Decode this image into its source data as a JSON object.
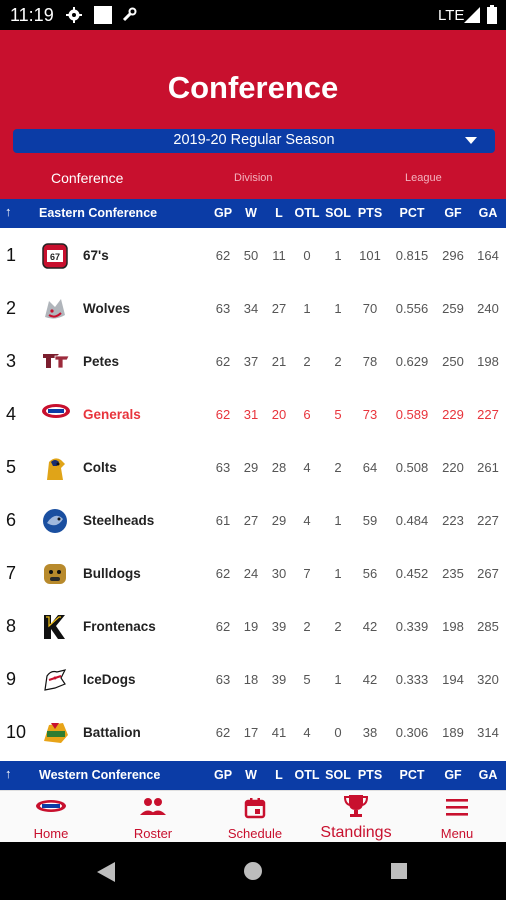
{
  "status_bar": {
    "time": "11:19",
    "network": "LTE"
  },
  "header": {
    "title": "Conference",
    "season": "2019-20 Regular Season",
    "tabs": [
      "Conference",
      "Division",
      "League"
    ]
  },
  "table": {
    "columns": [
      "GP",
      "W",
      "L",
      "OTL",
      "SOL",
      "PTS",
      "PCT",
      "GF",
      "GA"
    ],
    "eastern_title": "Eastern Conference",
    "western_title": "Western Conference",
    "rows": [
      {
        "rank": "1",
        "team": "67's",
        "logo": "67s-logo",
        "gp": "62",
        "w": "50",
        "l": "11",
        "otl": "0",
        "sol": "1",
        "pts": "101",
        "pct": "0.815",
        "gf": "296",
        "ga": "164"
      },
      {
        "rank": "2",
        "team": "Wolves",
        "logo": "wolves-logo",
        "gp": "63",
        "w": "34",
        "l": "27",
        "otl": "1",
        "sol": "1",
        "pts": "70",
        "pct": "0.556",
        "gf": "259",
        "ga": "240"
      },
      {
        "rank": "3",
        "team": "Petes",
        "logo": "petes-logo",
        "gp": "62",
        "w": "37",
        "l": "21",
        "otl": "2",
        "sol": "2",
        "pts": "78",
        "pct": "0.629",
        "gf": "250",
        "ga": "198"
      },
      {
        "rank": "4",
        "team": "Generals",
        "logo": "generals-logo",
        "gp": "62",
        "w": "31",
        "l": "20",
        "otl": "6",
        "sol": "5",
        "pts": "73",
        "pct": "0.589",
        "gf": "229",
        "ga": "227"
      },
      {
        "rank": "5",
        "team": "Colts",
        "logo": "colts-logo",
        "gp": "63",
        "w": "29",
        "l": "28",
        "otl": "4",
        "sol": "2",
        "pts": "64",
        "pct": "0.508",
        "gf": "220",
        "ga": "261"
      },
      {
        "rank": "6",
        "team": "Steelheads",
        "logo": "steelheads-logo",
        "gp": "61",
        "w": "27",
        "l": "29",
        "otl": "4",
        "sol": "1",
        "pts": "59",
        "pct": "0.484",
        "gf": "223",
        "ga": "227"
      },
      {
        "rank": "7",
        "team": "Bulldogs",
        "logo": "bulldogs-logo",
        "gp": "62",
        "w": "24",
        "l": "30",
        "otl": "7",
        "sol": "1",
        "pts": "56",
        "pct": "0.452",
        "gf": "235",
        "ga": "267"
      },
      {
        "rank": "8",
        "team": "Frontenacs",
        "logo": "frontenacs-logo",
        "gp": "62",
        "w": "19",
        "l": "39",
        "otl": "2",
        "sol": "2",
        "pts": "42",
        "pct": "0.339",
        "gf": "198",
        "ga": "285"
      },
      {
        "rank": "9",
        "team": "IceDogs",
        "logo": "icedogs-logo",
        "gp": "63",
        "w": "18",
        "l": "39",
        "otl": "5",
        "sol": "1",
        "pts": "42",
        "pct": "0.333",
        "gf": "194",
        "ga": "320"
      },
      {
        "rank": "10",
        "team": "Battalion",
        "logo": "battalion-logo",
        "gp": "62",
        "w": "17",
        "l": "41",
        "otl": "4",
        "sol": "0",
        "pts": "38",
        "pct": "0.306",
        "gf": "189",
        "ga": "314"
      }
    ],
    "highlight_team": "Generals"
  },
  "bottom_nav": {
    "items": [
      {
        "label": "Home",
        "icon": "generals-logo-icon"
      },
      {
        "label": "Roster",
        "icon": "people-icon"
      },
      {
        "label": "Schedule",
        "icon": "calendar-icon"
      },
      {
        "label": "Standings",
        "icon": "trophy-icon"
      },
      {
        "label": "Menu",
        "icon": "menu-icon"
      }
    ],
    "active": "Standings"
  },
  "colors": {
    "brand_red": "#c8102e",
    "brand_blue": "#0b3ca6",
    "highlight": "#e8343c"
  }
}
